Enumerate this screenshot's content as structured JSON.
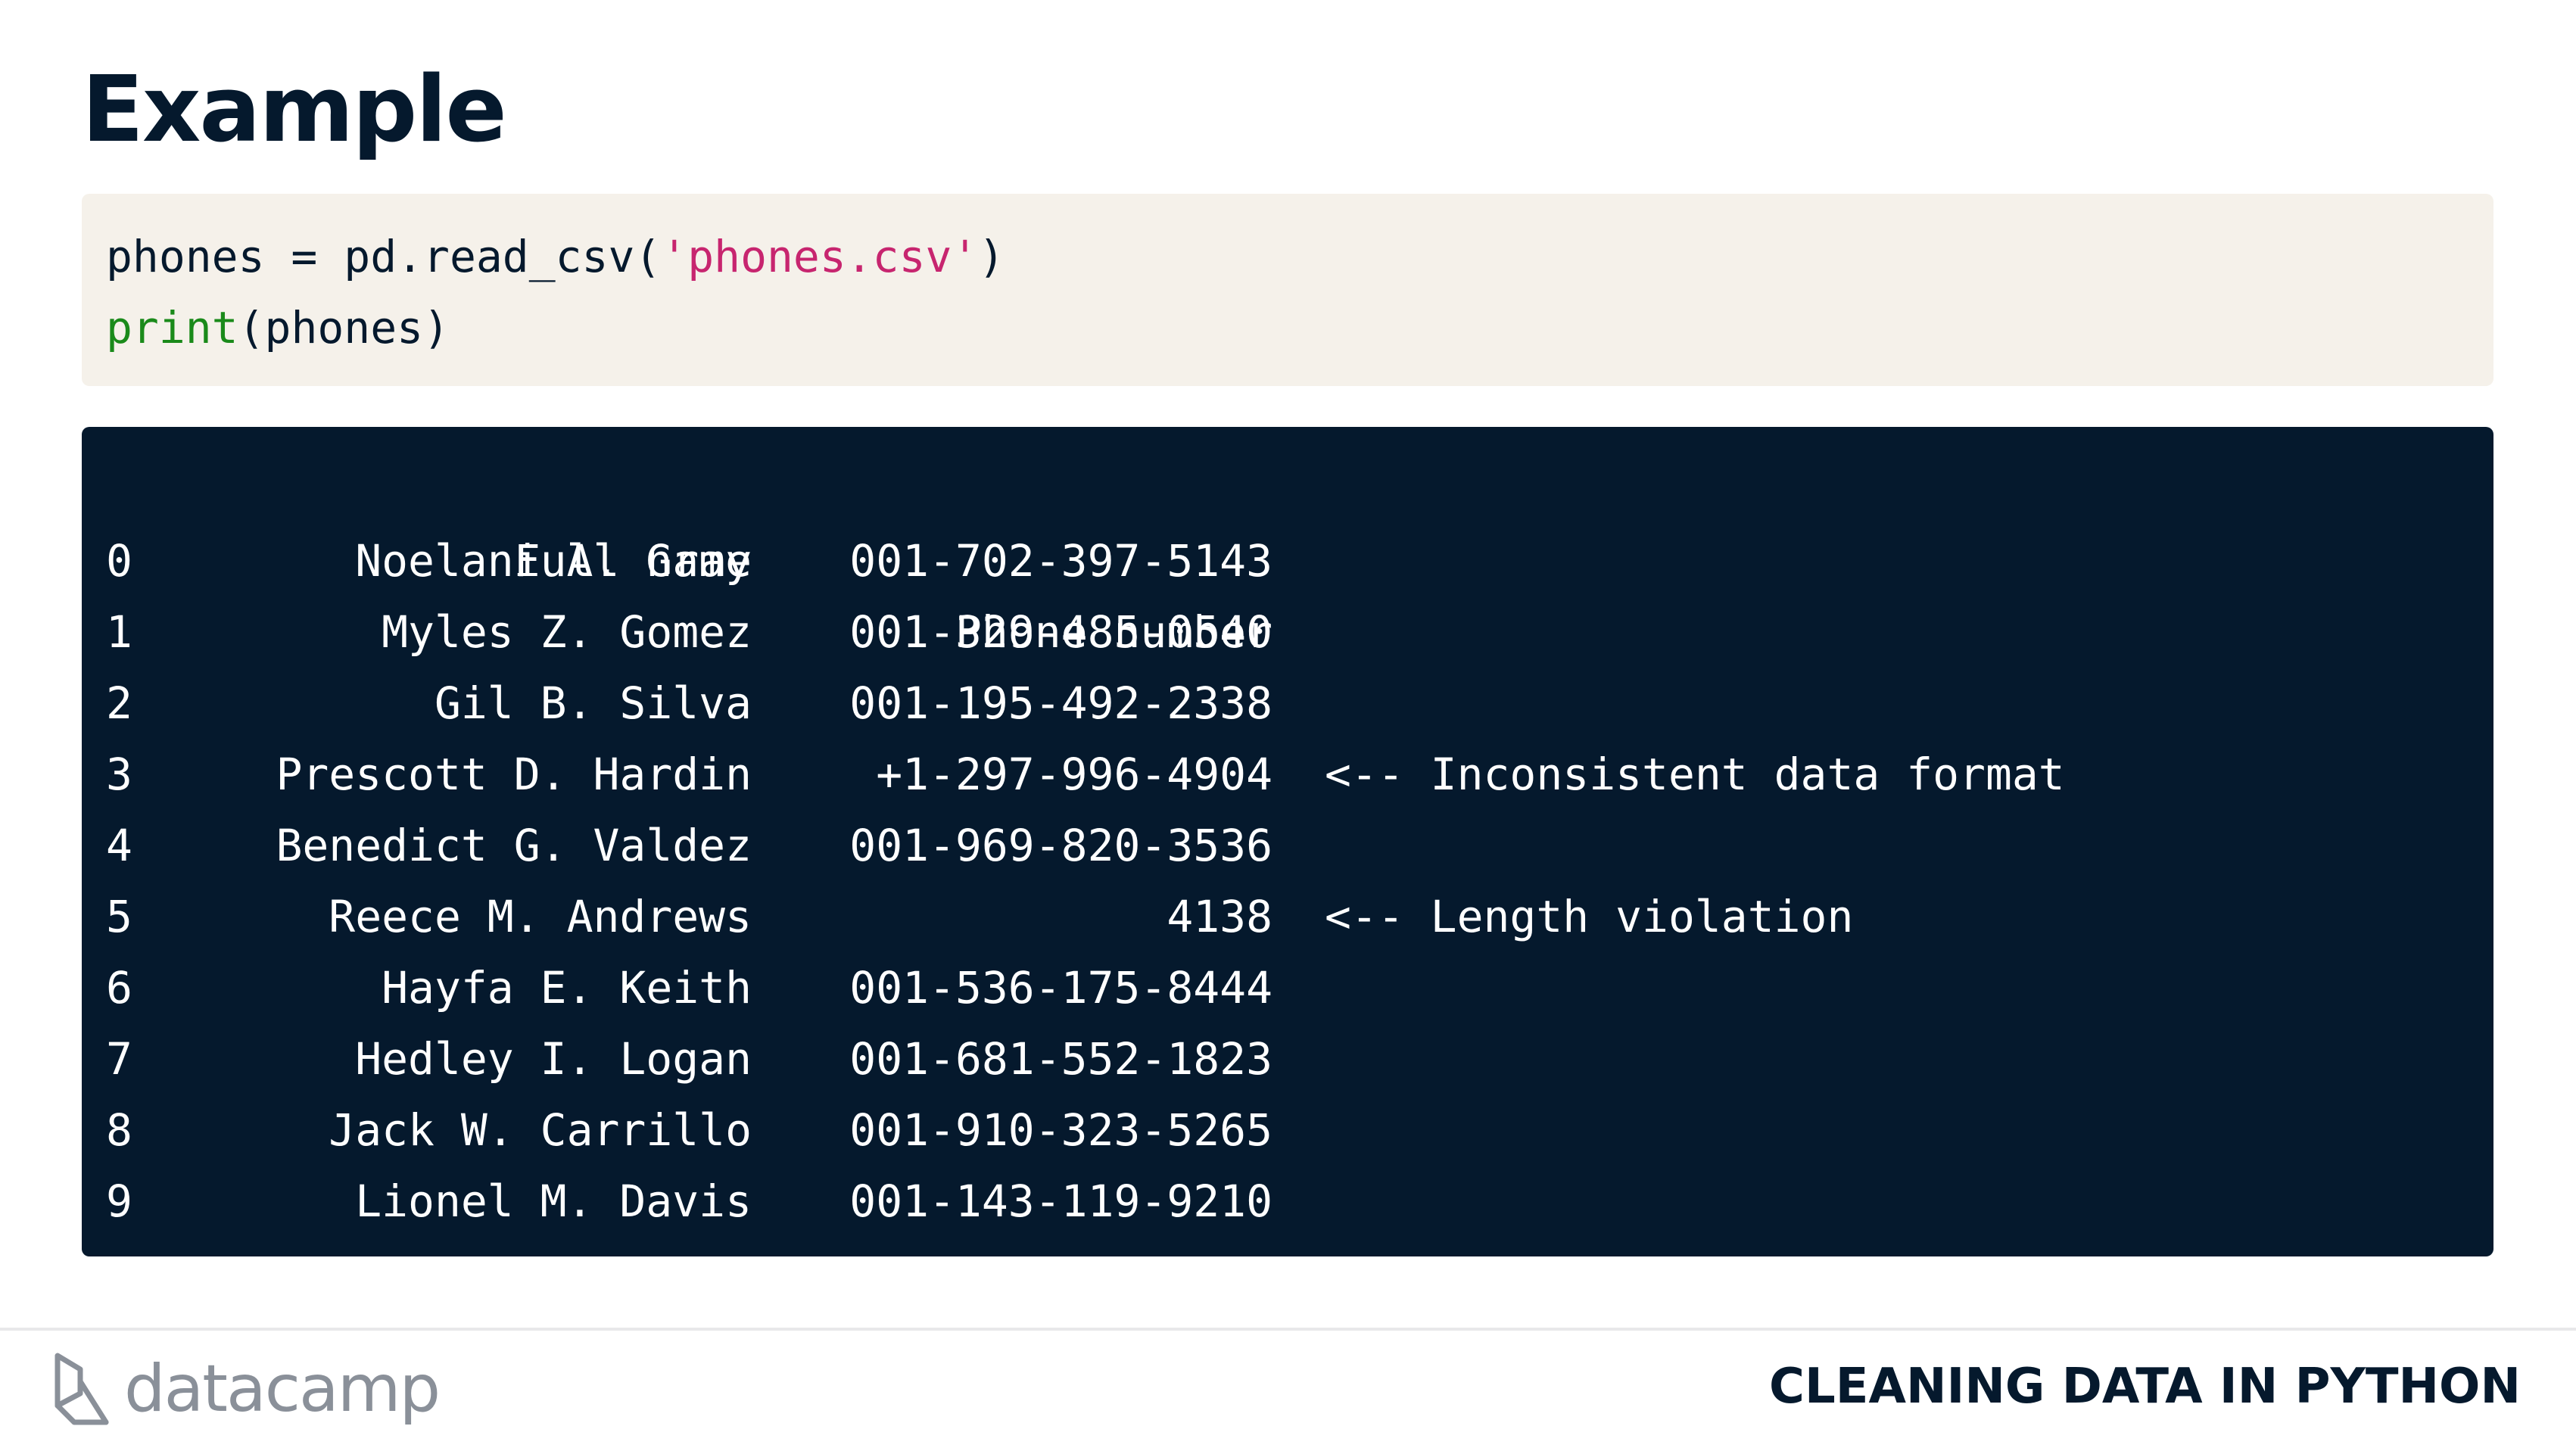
{
  "slide": {
    "title": "Example",
    "course_title": "CLEANING DATA IN PYTHON",
    "brand": "datacamp"
  },
  "code": {
    "line1": {
      "pre": "phones = pd.read_csv(",
      "string": "'phones.csv'",
      "post": ")"
    },
    "line2": {
      "fn": "print",
      "args": "(phones)"
    }
  },
  "output": {
    "columns": [
      "Full name",
      "Phone number"
    ],
    "rows": [
      {
        "index": "0",
        "name": "Noelani A. Gray",
        "phone": "001-702-397-5143",
        "note": ""
      },
      {
        "index": "1",
        "name": "Myles Z. Gomez",
        "phone": "001-329-485-0540",
        "note": ""
      },
      {
        "index": "2",
        "name": "Gil B. Silva",
        "phone": "001-195-492-2338",
        "note": ""
      },
      {
        "index": "3",
        "name": "Prescott D. Hardin",
        "phone": "+1-297-996-4904",
        "note": "<-- Inconsistent data format"
      },
      {
        "index": "4",
        "name": "Benedict G. Valdez",
        "phone": "001-969-820-3536",
        "note": ""
      },
      {
        "index": "5",
        "name": "Reece M. Andrews",
        "phone": "4138",
        "note": "<-- Length violation"
      },
      {
        "index": "6",
        "name": "Hayfa E. Keith",
        "phone": "001-536-175-8444",
        "note": ""
      },
      {
        "index": "7",
        "name": "Hedley I. Logan",
        "phone": "001-681-552-1823",
        "note": ""
      },
      {
        "index": "8",
        "name": "Jack W. Carrillo",
        "phone": "001-910-323-5265",
        "note": ""
      },
      {
        "index": "9",
        "name": "Lionel M. Davis",
        "phone": "001-143-119-9210",
        "note": ""
      }
    ]
  },
  "colors": {
    "navy": "#05192d",
    "code_bg": "#f5f1ea",
    "string": "#c7256f",
    "builtin": "#1a8a1a",
    "logo_gray": "#8a9099"
  }
}
